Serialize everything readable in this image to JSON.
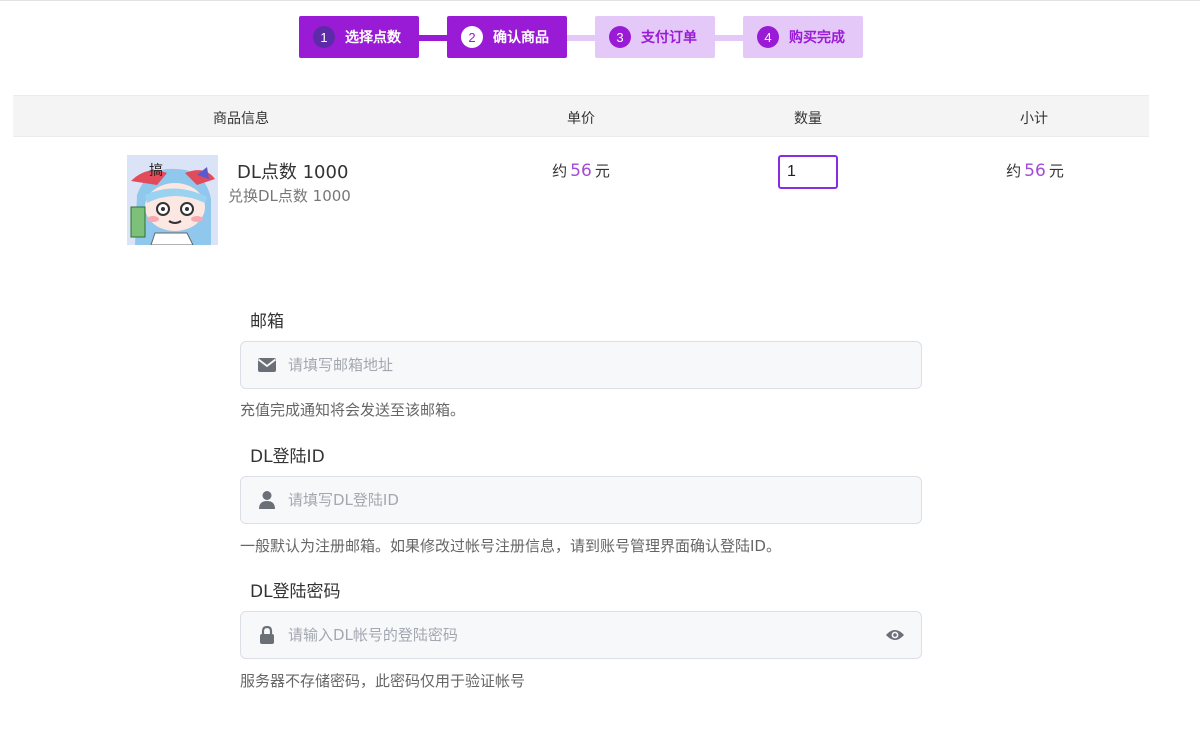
{
  "steps": [
    {
      "num": "1",
      "label": "选择点数"
    },
    {
      "num": "2",
      "label": "确认商品"
    },
    {
      "num": "3",
      "label": "支付订单"
    },
    {
      "num": "4",
      "label": "购买完成"
    }
  ],
  "table": {
    "headers": [
      "商品信息",
      "单价",
      "数量",
      "小计"
    ],
    "row": {
      "image_text": "搞",
      "name": "DL点数 1000",
      "desc": "兑换DL点数 1000",
      "price_prefix": "约",
      "price_value": "56",
      "price_unit": "元",
      "quantity": "1",
      "subtotal_prefix": "约",
      "subtotal_value": "56",
      "subtotal_unit": "元"
    }
  },
  "form": {
    "email": {
      "label": "邮箱",
      "placeholder": "请填写邮箱地址",
      "help": "充值完成通知将会发送至该邮箱。"
    },
    "dlid": {
      "label": "DL登陆ID",
      "placeholder": "请填写DL登陆ID",
      "help": "一般默认为注册邮箱。如果修改过帐号注册信息，请到账号管理界面确认登陆ID。"
    },
    "password": {
      "label": "DL登陆密码",
      "placeholder": "请输入DL帐号的登陆密码",
      "help": "服务器不存储密码，此密码仅用于验证帐号"
    }
  },
  "colors": {
    "accent": "#9a1bd6",
    "accent_light": "#e4c8f8",
    "price": "#a24bd8"
  },
  "icons": {
    "email": "envelope-icon",
    "dlid": "user-icon",
    "password": "lock-icon",
    "toggle": "eye-icon"
  }
}
